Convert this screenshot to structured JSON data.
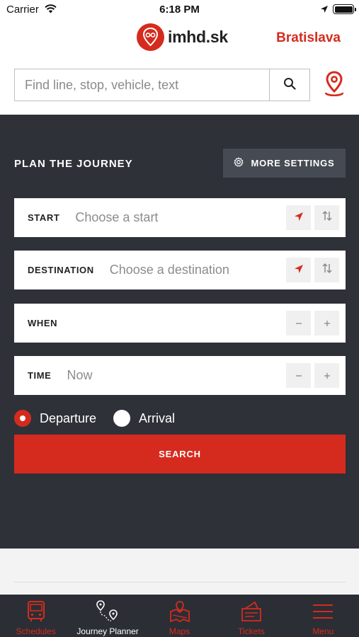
{
  "status_bar": {
    "carrier": "Carrier",
    "time": "6:18 PM"
  },
  "header": {
    "logo_text": "imhd.sk",
    "city": "Bratislava"
  },
  "search": {
    "placeholder": "Find line, stop, vehicle, text"
  },
  "planner": {
    "title": "PLAN THE JOURNEY",
    "more_settings": "MORE SETTINGS",
    "fields": [
      {
        "label": "START",
        "placeholder": "Choose a start"
      },
      {
        "label": "DESTINATION",
        "placeholder": "Choose a destination"
      },
      {
        "label": "WHEN",
        "placeholder": ""
      },
      {
        "label": "TIME",
        "placeholder": "Now"
      }
    ],
    "radio": {
      "departure": "Departure",
      "arrival": "Arrival",
      "selected": "Departure"
    },
    "search_button": "SEARCH"
  },
  "tabbar": {
    "tabs": [
      {
        "label": "Schedules",
        "icon": "bus-icon"
      },
      {
        "label": "Journey Planner",
        "icon": "route-icon"
      },
      {
        "label": "Maps",
        "icon": "map-icon"
      },
      {
        "label": "Tickets",
        "icon": "ticket-icon"
      },
      {
        "label": "Menu",
        "icon": "menu-icon"
      }
    ],
    "active": "Journey Planner"
  },
  "colors": {
    "accent": "#d52b1e",
    "panel": "#2e3138",
    "tabbar": "#2b2e35"
  }
}
